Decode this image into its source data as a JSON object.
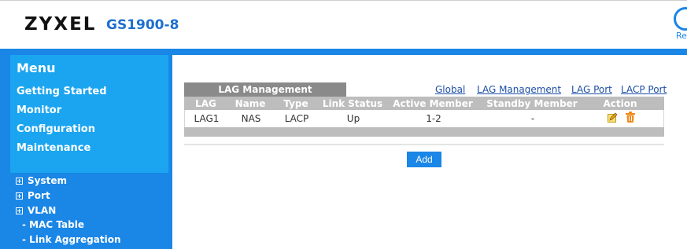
{
  "header": {
    "brand": "ZYXEL",
    "model": "GS1900-8",
    "right_label": "Re"
  },
  "sidebar": {
    "menu_title": "Menu",
    "menu_items": [
      "Getting Started",
      "Monitor",
      "Configuration",
      "Maintenance"
    ],
    "tree": [
      "System",
      "Port",
      "VLAN"
    ],
    "sub_items": [
      "MAC Table",
      "Link Aggregation"
    ]
  },
  "main": {
    "section_title": "LAG Management",
    "links": [
      "Global",
      "LAG Management",
      "LAG Port",
      "LACP Port"
    ],
    "columns": [
      "LAG",
      "Name",
      "Type",
      "Link Status",
      "Active Member",
      "Standby Member",
      "Action"
    ],
    "rows": [
      {
        "lag": "LAG1",
        "name": "NAS",
        "type": "LACP",
        "link_status": "Up",
        "active_member": "1-2",
        "standby_member": "-"
      }
    ],
    "add_label": "Add"
  },
  "colors": {
    "accent": "#1a86e6",
    "menu_panel": "#1ba5f0",
    "table_header": "#bdbdbd",
    "tab": "#8a8a8a",
    "link": "#1d4fa8"
  }
}
